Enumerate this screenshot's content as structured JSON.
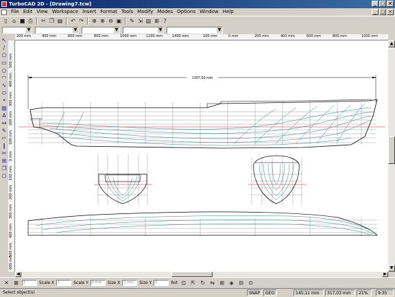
{
  "window": {
    "title": "TurboCAD 2D - [Drawing7.tcw]",
    "minimize_glyph": "_",
    "maximize_glyph": "□",
    "close_glyph": "×"
  },
  "menu": {
    "items": [
      "File",
      "Edit",
      "View",
      "Workspace",
      "Insert",
      "Format",
      "Tools",
      "Modify",
      "Modes",
      "Options",
      "Window",
      "Help"
    ]
  },
  "toolbar": {
    "icons": [
      "new-icon",
      "open-icon",
      "save-icon",
      "print-icon",
      "cut-icon",
      "copy-icon",
      "paste-icon",
      "undo-icon",
      "redo-icon",
      "zoom-window-icon",
      "zoom-in-icon",
      "zoom-out-icon",
      "snap-icon",
      "arrow-icon",
      "layer-icon",
      "properties-icon",
      "help-icon"
    ]
  },
  "rulers": {
    "horizontal_labels": [
      "200 mm",
      "400 mm",
      "600 mm",
      "800 mm",
      "1000 mm",
      "1200 mm",
      "1400 mm",
      "100 mm",
      "0 mm",
      "200 mm",
      "400 mm",
      "600 mm",
      "800 mm",
      "1000 mm"
    ],
    "vertical_labels": [
      "500 mm",
      "400 mm",
      "300 mm",
      "200 mm",
      "100 mm",
      "0 mm",
      "100 mm",
      "200 mm",
      "300 mm",
      "400 mm",
      "500 mm",
      "600 mm"
    ]
  },
  "drawing": {
    "dimension_text": "1397,69 mm"
  },
  "inspector": {
    "scale_x_label": "Scale X",
    "scale_y_label": "Scale Y",
    "size_x_label": "Size X",
    "size_y_label": "Size Y",
    "rot_label": "Rot",
    "scale_x_value": "1",
    "scale_y_value": "1",
    "size_x_value": "0 mm",
    "size_y_value": "0 mm",
    "rot_value": "0"
  },
  "status": {
    "message": "Select object(s)",
    "snap": "SNAP",
    "geo": "GEO",
    "x_coord": "145,11 mm",
    "y_coord": "317,03 mm",
    "zoom": "21%",
    "time": "9:35"
  }
}
